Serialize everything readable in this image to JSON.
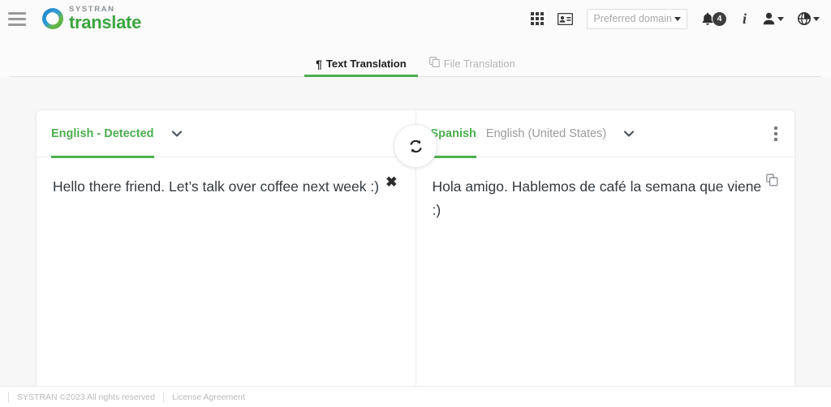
{
  "header": {
    "menu_icon": "hamburger-menu-icon",
    "brand": {
      "sub": "SYSTRAN",
      "main": "translate"
    },
    "apps_icon": "apps-grid-icon",
    "card_icon": "id-card-icon",
    "domain_select": {
      "value": "Preferred domain",
      "caret": "caret-down-icon"
    },
    "notifications": {
      "icon": "bell-icon",
      "count": "4"
    },
    "info_icon": "i",
    "account_icon": "user-icon",
    "language_icon": "globe-icon"
  },
  "tabs": [
    {
      "label": "Text Translation",
      "icon": "pilcrow-icon",
      "glyph": "¶",
      "active": true
    },
    {
      "label": "File Translation",
      "icon": "file-copy-icon",
      "glyph": "",
      "active": false
    }
  ],
  "translation": {
    "source": {
      "language_label": "English - Detected",
      "chevron": "chevron-down-icon",
      "text": "Hello there friend. Let’s talk over coffee next week :)",
      "clear_label": "✖",
      "clear_icon": "close-icon"
    },
    "swap": {
      "icon": "swap-languages-icon"
    },
    "target": {
      "language_primary": "Spanish",
      "language_secondary": "English (United States)",
      "chevron": "chevron-down-icon",
      "text": "Hola amigo. Hablemos de café la semana que viene :)",
      "copy_icon": "copy-icon",
      "more_icon": "kebab-menu-icon"
    }
  },
  "footer": {
    "copyright": "SYSTRAN ©2023 All rights reserved",
    "license_link": "License Agreement"
  },
  "colors": {
    "accent_green": "#4caf50",
    "brand_green": "#3aa540",
    "page_bg": "#f7f7f7",
    "badge_bg": "#3d3d3d"
  }
}
